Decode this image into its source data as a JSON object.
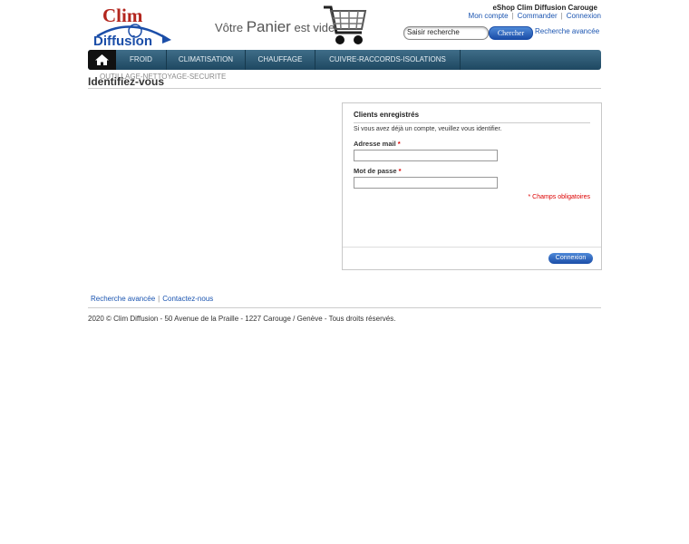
{
  "header": {
    "logo_line1": "Clim",
    "logo_line2": "Diffusion",
    "cart_prefix": "Vôtre",
    "cart_big": "Panier",
    "cart_suffix": "est vide.",
    "shop_name": "eShop Clim Diffusion Carouge",
    "links": [
      "Mon compte",
      "Commander",
      "Connexion"
    ],
    "search_placeholder": "Saisir recherche",
    "search_button": "Chercher",
    "advanced_search": "Recherche avancée"
  },
  "nav": {
    "items": [
      "FROID",
      "CLIMATISATION",
      "CHAUFFAGE",
      "CUIVRE-RACCORDS-ISOLATIONS"
    ],
    "submenu": "OUTILLAGE-NETTOYAGE-SECURITE"
  },
  "page": {
    "title": "Identifiez-vous"
  },
  "login": {
    "heading": "Clients enregistrés",
    "intro": "Si vous avez déjà un compte, veuillez vous identifier.",
    "email_label": "Adresse mail",
    "password_label": "Mot de passe",
    "required_mark": "*",
    "required_note": "* Champs obligatoires",
    "submit": "Connexion"
  },
  "footer": {
    "links": [
      "Recherche avancée",
      "Contactez-nous"
    ],
    "copyright": "2020 © Clim Diffusion - 50 Avenue de la Praille - 1227 Carouge / Genève - Tous droits réservés."
  },
  "colors": {
    "link": "#1a54b0",
    "nav_bg": "#2a5873",
    "button": "#1b4ea8",
    "required": "#dd0000",
    "logo_red": "#b3261e"
  }
}
